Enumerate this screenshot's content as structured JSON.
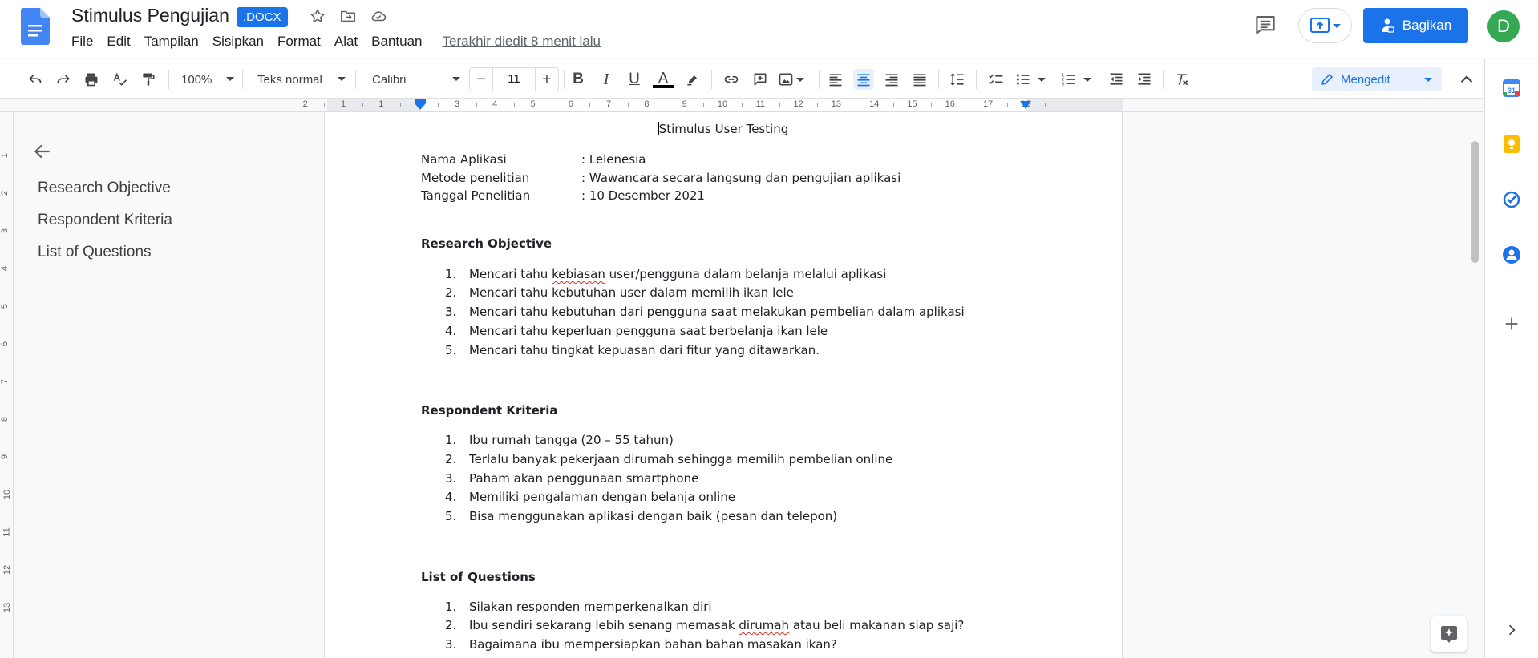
{
  "header": {
    "title": "Stimulus Pengujian",
    "badge": ".DOCX",
    "last_edit": "Terakhir diedit 8 menit lalu",
    "share_label": "Bagikan",
    "avatar_letter": "D"
  },
  "menu": [
    "File",
    "Edit",
    "Tampilan",
    "Sisipkan",
    "Format",
    "Alat",
    "Bantuan"
  ],
  "toolbar": {
    "zoom": "100%",
    "style": "Teks normal",
    "font": "Calibri",
    "font_size": "11",
    "mode": "Mengedit"
  },
  "ruler": {
    "marks": [
      "2",
      "1",
      "1",
      "2",
      "3",
      "4",
      "5",
      "6",
      "7",
      "8",
      "9",
      "10",
      "11",
      "12",
      "13",
      "14",
      "15",
      "16",
      "17",
      "18"
    ]
  },
  "ruler_v": [
    "1",
    "2",
    "3",
    "4",
    "5",
    "6",
    "7",
    "8",
    "9",
    "10",
    "11",
    "12",
    "13"
  ],
  "outline": {
    "items": [
      "Research Objective",
      "Respondent Kriteria",
      "List of Questions"
    ]
  },
  "document": {
    "title": "Stimulus User Testing",
    "info": [
      {
        "label": "Nama Aplikasi",
        "value": ": Lelenesia"
      },
      {
        "label": "Metode penelitian",
        "value": ": Wawancara secara langsung dan pengujian aplikasi"
      },
      {
        "label": "Tanggal Penelitian",
        "value": ":  10 Desember 2021"
      }
    ],
    "sections": [
      {
        "heading": "Research Objective",
        "items": [
          {
            "pre": "Mencari tahu ",
            "err": "kebiasan",
            "post": " user/pengguna dalam belanja melalui aplikasi"
          },
          {
            "pre": "Mencari tahu kebutuhan user dalam memilih ikan lele",
            "err": "",
            "post": ""
          },
          {
            "pre": "Mencari tahu kebutuhan dari pengguna saat melakukan pembelian dalam aplikasi",
            "err": "",
            "post": ""
          },
          {
            "pre": "Mencari tahu keperluan pengguna saat berbelanja ikan lele",
            "err": "",
            "post": ""
          },
          {
            "pre": "Mencari tahu tingkat kepuasan dari fitur yang ditawarkan.",
            "err": "",
            "post": ""
          }
        ]
      },
      {
        "heading": "Respondent Kriteria",
        "items": [
          {
            "pre": "Ibu rumah tangga (20 – 55 tahun)",
            "err": "",
            "post": ""
          },
          {
            "pre": "Terlalu banyak pekerjaan dirumah sehingga memilih pembelian online",
            "err": "",
            "post": ""
          },
          {
            "pre": "Paham akan penggunaan smartphone",
            "err": "",
            "post": ""
          },
          {
            "pre": "Memiliki pengalaman dengan belanja online",
            "err": "",
            "post": ""
          },
          {
            "pre": "Bisa menggunakan aplikasi dengan baik (pesan dan telepon)",
            "err": "",
            "post": ""
          }
        ]
      },
      {
        "heading": "List of Questions",
        "items": [
          {
            "pre": "Silakan responden memperkenalkan diri",
            "err": "",
            "post": ""
          },
          {
            "pre": "Ibu sendiri sekarang lebih senang memasak ",
            "err": "dirumah",
            "post": " atau beli makanan siap saji?"
          },
          {
            "pre": "Bagaimana ibu mempersiapkan bahan bahan masakan ikan?",
            "err": "",
            "post": ""
          }
        ]
      }
    ]
  },
  "colors": {
    "accent": "#1a73e8",
    "avatar": "#34a853",
    "spell_error": "#d93025"
  }
}
